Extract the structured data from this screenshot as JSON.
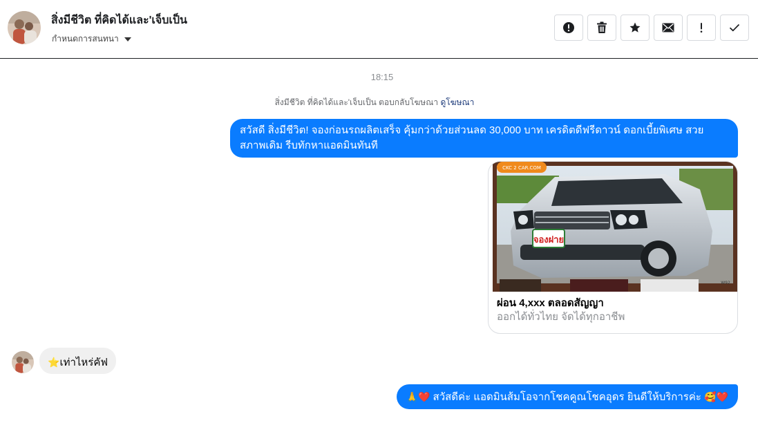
{
  "header": {
    "name": "สิ่งมีชีวิต ที่คิดได้และ'เจ็บเป็น",
    "subtitle": "กำหนดการสนทนา",
    "actions": [
      {
        "name": "report-icon",
        "label": "!"
      },
      {
        "name": "trash-icon"
      },
      {
        "name": "star-icon"
      },
      {
        "name": "mail-icon"
      },
      {
        "name": "exclamation-icon",
        "label": "!"
      },
      {
        "name": "check-icon"
      }
    ]
  },
  "thread": {
    "time": "18:15",
    "reply_note": {
      "text": "สิ่งมีชีวิต ที่คิดได้และ'เจ็บเป็น ตอบกลับโฆษณา",
      "link": "ดูโฆษณา"
    },
    "messages": [
      {
        "direction": "out",
        "text": "สวัสดี สิ่งมีชีวิต! จองก่อนรถผลิตเสร็จ คุ้มกว่าด้วยส่วนลด 30,000 บาท เครดิตดีฟรีดาวน์ ดอกเบี้ยพิเศษ สวยสภาพเดิม รีบทักหาแอดมินทันที"
      },
      {
        "direction": "out",
        "type": "ad_card",
        "image_text": {
          "logo": "CKC 2 CAR.COM",
          "badge": "จองฝาย",
          "corner": "W92"
        },
        "title": "ผ่อน 4,xxx ตลอดสัญญา",
        "subtitle": "ออกได้ทั่วไทย จัดได้ทุกอาชีพ"
      },
      {
        "direction": "in",
        "emoji": "⭐",
        "text": "เท่าไหร่คัฟ"
      },
      {
        "direction": "out",
        "emoji_lead": "🙏❤️",
        "text": " สวัสดีค่ะ แอดมินส้มโอจากโชคคูณโชคอุดร ยินดีให้บริการค่ะ ",
        "emoji_tail": "🥰❤️"
      }
    ]
  },
  "colors": {
    "outgoing_bubble": "#0a7cff",
    "incoming_bubble": "#f0f0f0",
    "timestamp": "#8a8d91",
    "link": "#1c3a7a"
  }
}
